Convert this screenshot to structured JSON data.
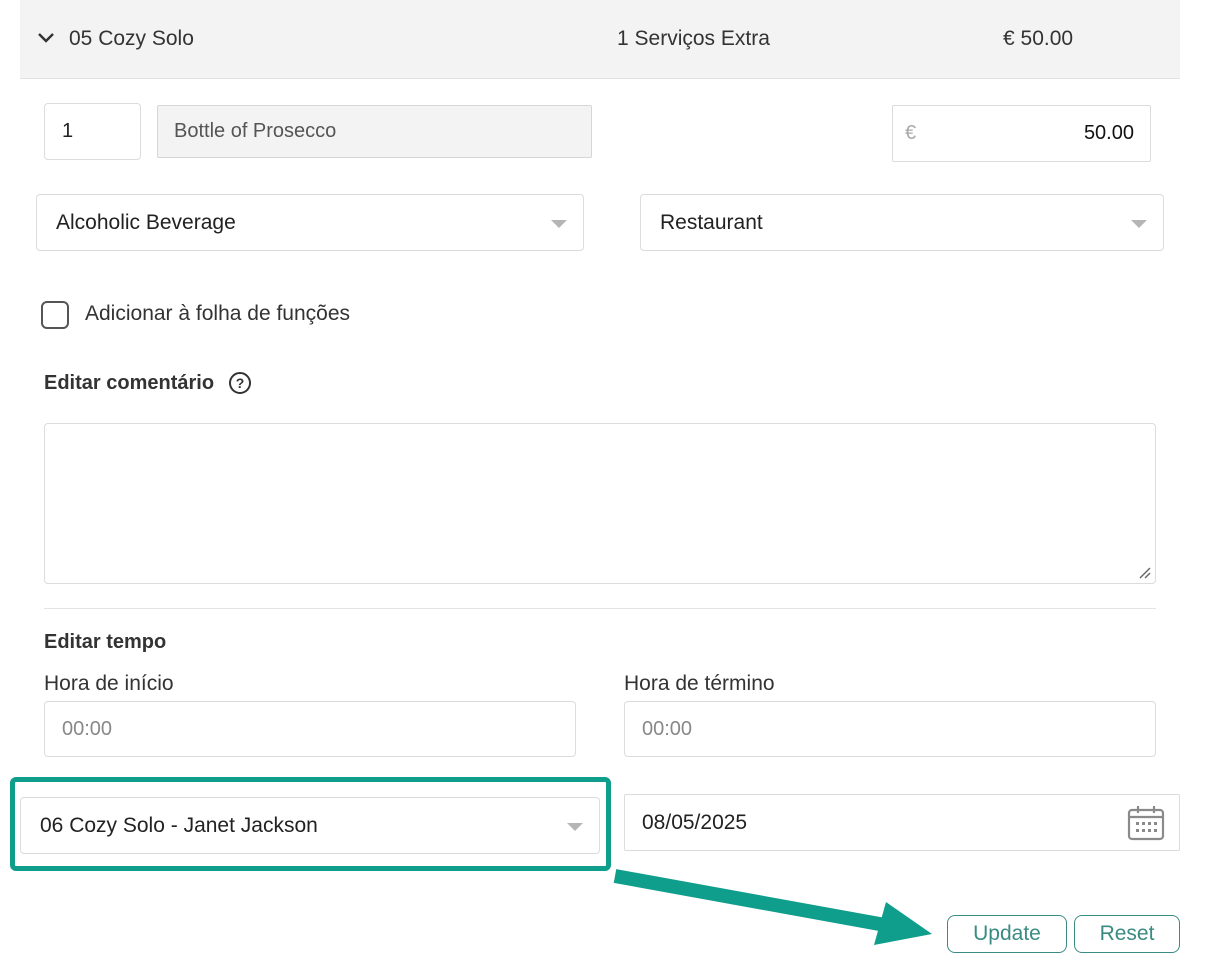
{
  "header": {
    "title": "05 Cozy Solo",
    "services": "1 Serviços Extra",
    "total": "€ 50.00"
  },
  "item": {
    "quantity": "1",
    "description": "Bottle of Prosecco",
    "currency": "€",
    "price": "50.00"
  },
  "selects": {
    "category": "Alcoholic Beverage",
    "department": "Restaurant"
  },
  "checkbox": {
    "label": "Adicionar à folha de funções",
    "checked": false
  },
  "comment": {
    "title": "Editar comentário",
    "help_symbol": "?",
    "value": ""
  },
  "time": {
    "title": "Editar tempo",
    "start_label": "Hora de início",
    "start_placeholder": "00:00",
    "end_label": "Hora de término",
    "end_placeholder": "00:00"
  },
  "booking": {
    "selected": "06 Cozy Solo - Janet Jackson"
  },
  "date": {
    "value": "08/05/2025"
  },
  "actions": {
    "update_label": "Update",
    "reset_label": "Reset"
  },
  "colors": {
    "accent": "#0f9e8c",
    "button": "#3a8b82",
    "header_bg": "#f3f3f3"
  },
  "icons": {
    "collapse": "chevron-down-icon",
    "help": "help-circle-icon",
    "calendar": "calendar-icon",
    "dropdown": "caret-down-icon"
  }
}
